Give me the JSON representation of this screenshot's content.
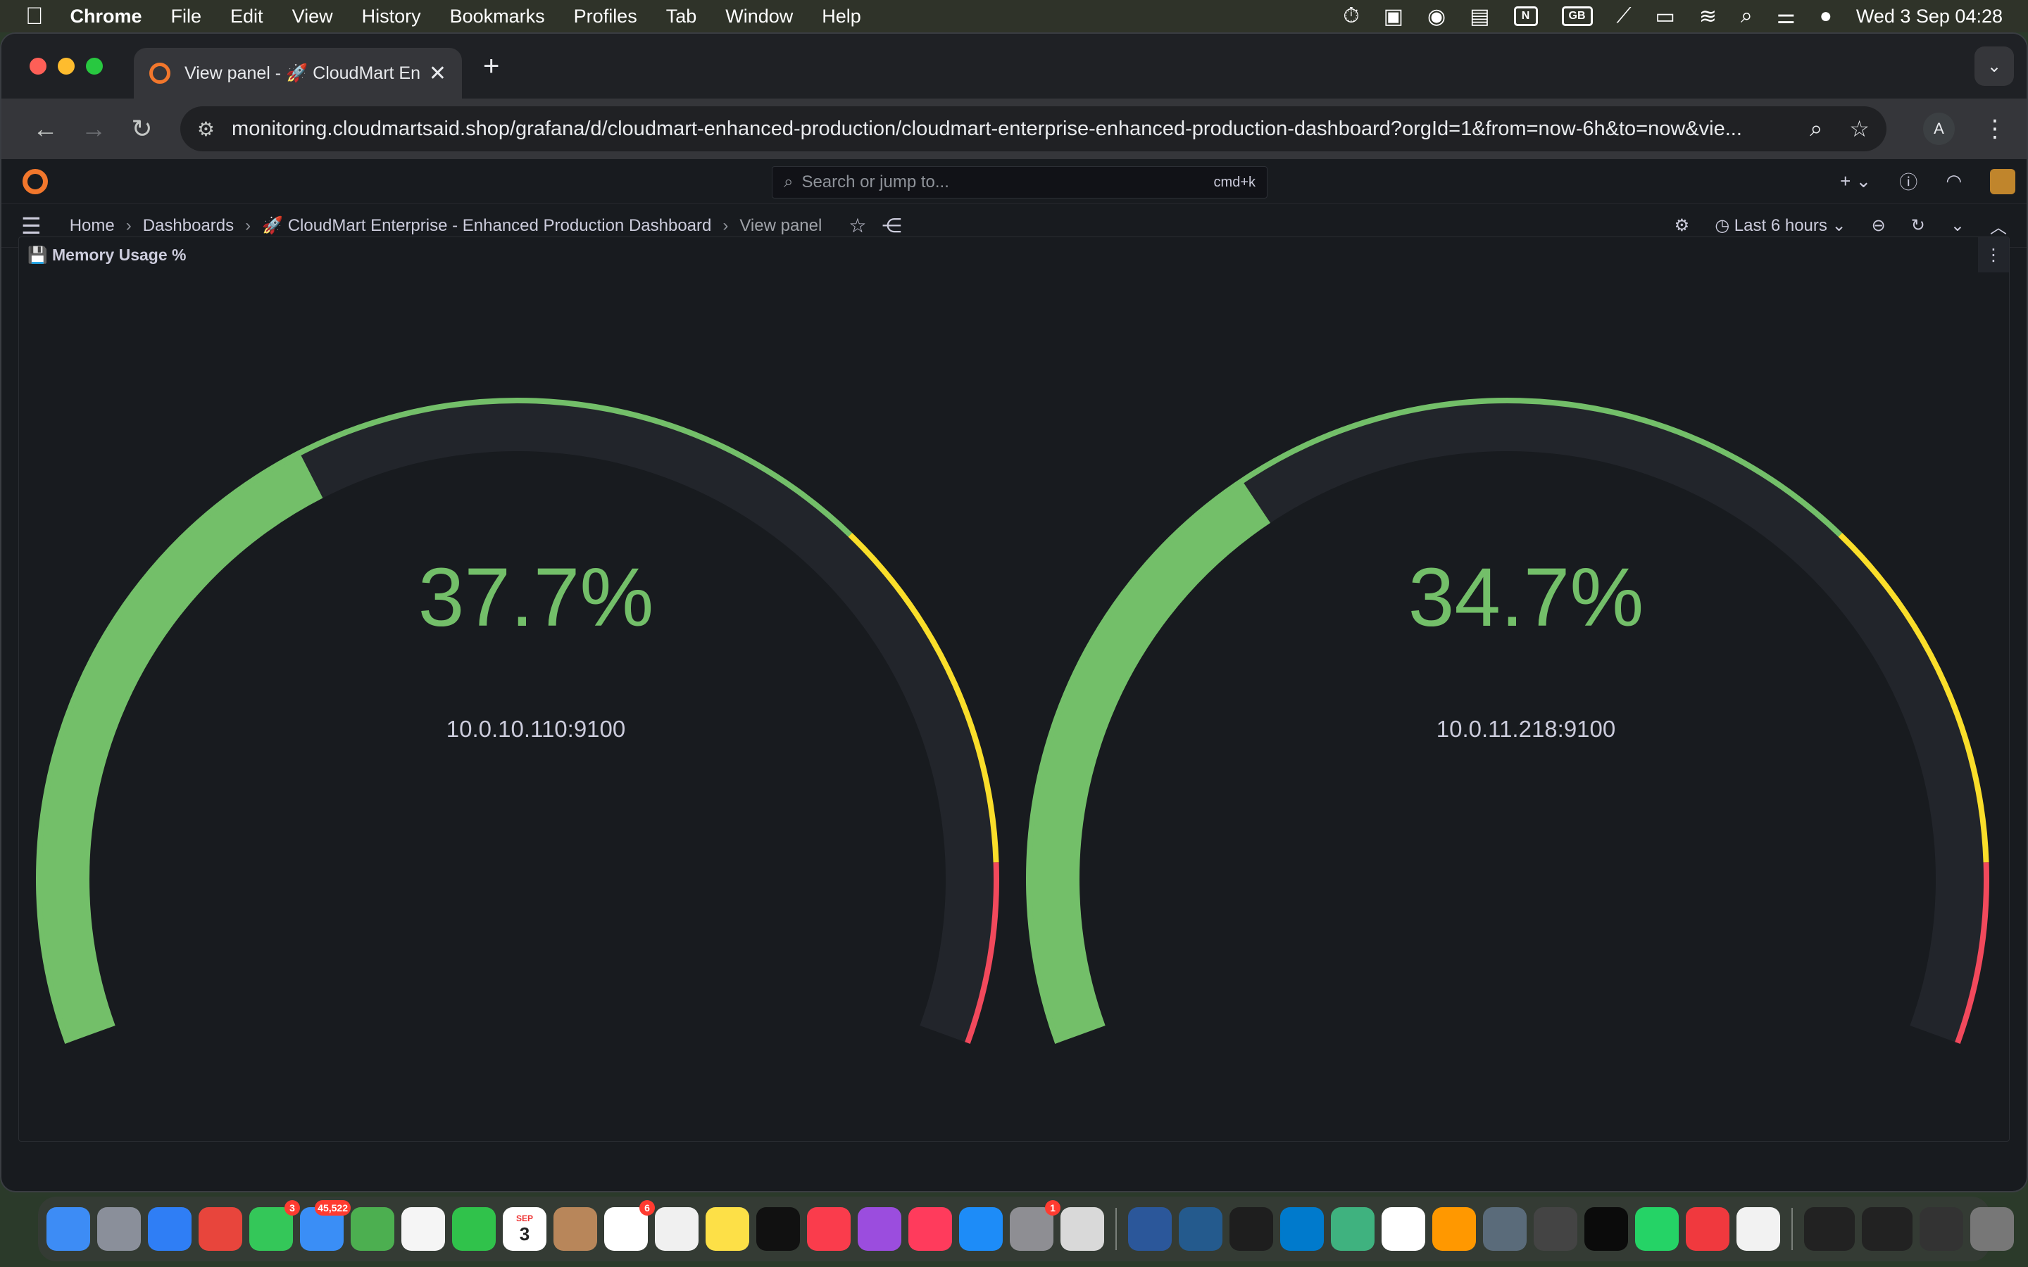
{
  "menubar": {
    "apple": "",
    "app_name": "Chrome",
    "items": [
      "File",
      "Edit",
      "View",
      "History",
      "Bookmarks",
      "Profiles",
      "Tab",
      "Window",
      "Help"
    ],
    "status_gb": "GB",
    "status_n": "N",
    "clock": "Wed 3 Sep  04:28"
  },
  "browser": {
    "tab_title": "View panel - 🚀 CloudMart Ent",
    "tab_close": "✕",
    "new_tab": "+",
    "url": "monitoring.cloudmartsaid.shop/grafana/d/cloudmart-enhanced-production/cloudmart-enterprise-enhanced-production-dashboard?orgId=1&from=now-6h&to=now&vie...",
    "profile_initial": "A"
  },
  "grafana": {
    "search_placeholder": "Search or jump to...",
    "search_shortcut": "cmd+k",
    "add_label": "+",
    "breadcrumb": {
      "home": "Home",
      "dashboards": "Dashboards",
      "dashboard": "🚀 CloudMart Enterprise - Enhanced Production Dashboard",
      "current": "View panel"
    },
    "time_range": "Last 6 hours"
  },
  "panel": {
    "title": "💾 Memory Usage %",
    "gauges": [
      {
        "value_text": "37.7%",
        "value": 37.7,
        "label": "10.0.10.110:9100"
      },
      {
        "value_text": "34.7%",
        "value": 34.7,
        "label": "10.0.11.218:9100"
      }
    ],
    "thresholds": {
      "min": 0,
      "max": 100,
      "yellow_from": 70,
      "red_from": 90
    },
    "colors": {
      "fill": "#73bf69",
      "track": "#22252b",
      "green": "#73bf69",
      "yellow": "#fade2a",
      "red": "#f2495c"
    }
  },
  "dock": {
    "badges": {
      "messages": "3",
      "mail": "45,522",
      "reminders": "6",
      "settings": "1",
      "calendar_month": "SEP",
      "calendar_day": "3"
    }
  }
}
